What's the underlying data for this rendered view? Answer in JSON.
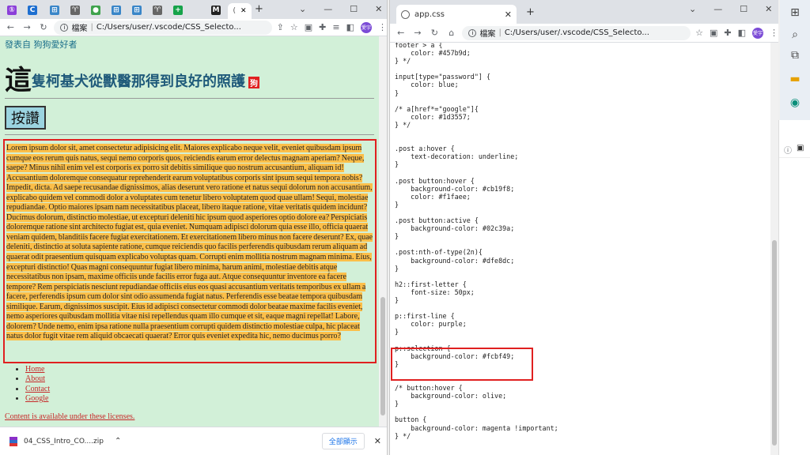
{
  "left_window": {
    "tab_favicons": [
      "①",
      "C",
      "⊞",
      "♈",
      "●",
      "⊞",
      "⊞",
      "♈",
      "+",
      "M"
    ],
    "active_tab_partial": "(",
    "close_tab": "✕",
    "new_tab": "+",
    "controls": [
      "⌄",
      "—",
      "☐",
      "✕"
    ],
    "address_prefix": "檔案",
    "address": "C:/Users/user/.vscode/CSS_Selecto...",
    "profile": "愛宇",
    "page": {
      "by_line": "發表自 狗狗愛好者",
      "headline_big": "這",
      "headline_rest": "隻柯基犬從獸醫那得到良好的照護",
      "headline_badge": "狗",
      "like_button": "按讚",
      "paragraph": "Lorem ipsum dolor sit, amet consectetur adipisicing elit. Maiores explicabo neque velit, eveniet quibusdam ipsum cumque eos rerum quis natus, sequi nemo corporis quos, reiciendis earum error delectus magnam aperiam? Neque, saepe? Minus nihil enim vel est corporis ex porro sit debitis similique quo nostrum accusantium, aliquam id! Accusantium doloremque consequatur reprehenderit earum voluptatibus corporis sint ipsum sequi tempora nobis? Impedit, dicta. Ad saepe recusandae dignissimos, alias deserunt vero ratione et natus sequi dolorum non accusantium, explicabo quidem vel commodi dolor a voluptates cum tenetur libero voluptatem quod quae ullam! Sequi, molestiae repudiandae. Optio maiores ipsam nam necessitatibus placeat, libero itaque ratione, vitae veritatis quidem incidunt? Ducimus dolorum, distinctio molestiae, ut excepturi deleniti hic ipsum quod asperiores optio dolore ea? Perspiciatis doloremque ratione sint architecto fugiat est, quia eveniet. Numquam adipisci dolorum quia esse illo, officia quaerat veniam quidem, blanditiis facere fugiat exercitationem. Et exercitationem libero minus non facere deserunt? Ex, quae deleniti, distinctio at soluta sapiente ratione, cumque reiciendis quo facilis perferendis quibusdam rerum aliquam ad quaerat odit praesentium quisquam explicabo voluptas quam. Corrupti enim mollitia nostrum magnam minima. Eius, excepturi distinctio! Quas magni consequuntur fugiat libero minima, harum animi, molestiae debitis atque necessitatibus non ipsam, maxime officiis unde facilis error fuga aut. Atque consequuntur inventore ea facere tempore? Rem perspiciatis nesciunt repudiandae officiis eius eos quasi accusantium veritatis temporibus ex ullam a facere, perferendis ipsum cum dolor sint odio assumenda fugiat natus. Perferendis esse beatae tempora quibusdam similique. Earum, dignissimos suscipit. Eius id adipisci consectetur commodi dolor beatae maxime facilis eveniet, nemo asperiores quibusdam mollitia vitae nisi repellendus quam illo cumque et sit, eaque magni repellat! Labore, dolorem? Unde nemo, enim ipsa ratione nulla praesentium corrupti quidem distinctio molestiae culpa, hic placeat natus dolor fugit vitae rem aliquid obcaecati quaerat? Error quis eveniet expedita hic, nemo ducimus porro?",
      "nav_links": [
        "Home",
        "About",
        "Contact",
        "Google"
      ],
      "license": "Content is available under these licenses."
    },
    "download": {
      "filename": "04_CSS_Intro_CO....zip",
      "chevron": "⌃",
      "show_all": "全部顯示",
      "close": "✕"
    }
  },
  "right_window": {
    "tab_title": "app.css",
    "close_tab": "✕",
    "new_tab": "+",
    "controls": [
      "⌄",
      "—",
      "☐",
      "✕"
    ],
    "address_prefix": "檔案",
    "address": "C:/Users/user/.vscode/CSS_Selecto...",
    "profile": "愛宇",
    "code": "footer > a {\n    color: #457b9d;\n} */\n\ninput[type=\"password\"] {\n    color: blue;\n}\n\n/* a[href*=\"google\"]{\n    color: #1d3557;\n} */\n\n\n.post a:hover {\n    text-decoration: underline;\n}\n\n.post button:hover {\n    background-color: #cb19f8;\n    color: #f1faee;\n}\n\n.post button:active {\n    background-color: #02c39a;\n}\n\n.post:nth-of-type(2n){\n    background-color: #dfe8dc;\n}\n\nh2::first-letter {\n    font-size: 50px;\n}\n\np::first-line {\n    color: purple;\n}\n\np::selection {\n    background-color: #fcbf49;\n}\n\n\n/* button:hover {\n    background-color: olive;\n}\n\nbutton {\n    background-color: magenta !important;\n} */"
  },
  "colors": {
    "selection": "#fcbf49",
    "page_bg": "#d2f0d8",
    "highlight_box": "#e02020"
  }
}
